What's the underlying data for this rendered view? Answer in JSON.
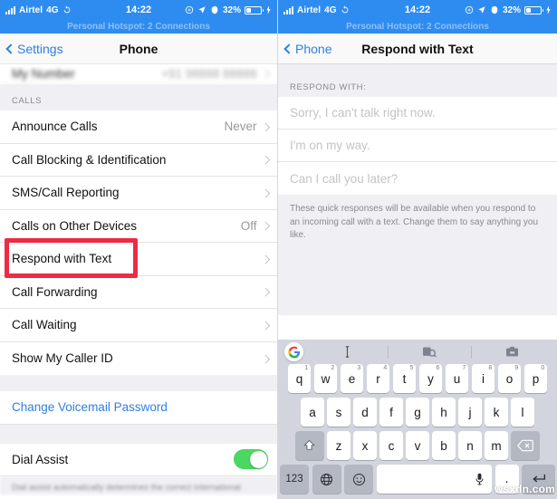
{
  "status_bar": {
    "carrier": "Airtel",
    "network": "4G",
    "time": "14:22",
    "battery_percent": "32%",
    "icons": [
      "signal-bars-icon",
      "sync-icon",
      "screen-mirroring-icon",
      "location-arrow-icon",
      "alarm-icon",
      "battery-icon",
      "charging-bolt-icon"
    ]
  },
  "hotspot_banner": "Personal Hotspot: 2 Connections",
  "left_screen": {
    "nav": {
      "back_label": "Settings",
      "title": "Phone"
    },
    "top_row": {
      "label": "My Number",
      "value": "+91 98888 88888"
    },
    "sections": [
      {
        "header": "CALLS",
        "rows": [
          {
            "label": "Announce Calls",
            "value": "Never",
            "chevron": true
          },
          {
            "label": "Call Blocking & Identification",
            "value": "",
            "chevron": true
          },
          {
            "label": "SMS/Call Reporting",
            "value": "",
            "chevron": true
          },
          {
            "label": "Calls on Other Devices",
            "value": "Off",
            "chevron": true
          },
          {
            "label": "Respond with Text",
            "value": "",
            "chevron": true
          },
          {
            "label": "Call Forwarding",
            "value": "",
            "chevron": true
          },
          {
            "label": "Call Waiting",
            "value": "",
            "chevron": true
          },
          {
            "label": "Show My Caller ID",
            "value": "",
            "chevron": true
          }
        ]
      }
    ],
    "voicemail_link": "Change Voicemail Password",
    "dial_assist": {
      "label": "Dial Assist",
      "enabled": true
    },
    "dial_assist_footnote": "Dial assist automatically determines the correct international"
  },
  "right_screen": {
    "nav": {
      "back_label": "Phone",
      "title": "Respond with Text"
    },
    "group_header": "RESPOND WITH:",
    "responses": [
      "Sorry, I can't talk right now.",
      "I'm on my way.",
      "Can I call you later?"
    ],
    "footnote": "These quick responses will be available when you respond to an incoming call with a text. Change them to say anything you like."
  },
  "keyboard": {
    "toolbar": [
      "google-logo-icon",
      "text-cursor-icon",
      "sticker-search-icon",
      "clipboard-icon"
    ],
    "row1": [
      {
        "key": "q",
        "num": "1"
      },
      {
        "key": "w",
        "num": "2"
      },
      {
        "key": "e",
        "num": "3"
      },
      {
        "key": "r",
        "num": "4"
      },
      {
        "key": "t",
        "num": "5"
      },
      {
        "key": "y",
        "num": "6"
      },
      {
        "key": "u",
        "num": "7"
      },
      {
        "key": "i",
        "num": "8"
      },
      {
        "key": "o",
        "num": "9"
      },
      {
        "key": "p",
        "num": "0"
      }
    ],
    "row2": [
      "a",
      "s",
      "d",
      "f",
      "g",
      "h",
      "j",
      "k",
      "l"
    ],
    "row3": [
      "z",
      "x",
      "c",
      "v",
      "b",
      "n",
      "m"
    ],
    "shift_label": "shift-icon",
    "backspace_label": "backspace-icon",
    "numbers_key": "123",
    "globe_key": "globe-icon",
    "emoji_key": "emoji-icon",
    "space_key": "",
    "mic_icon": "mic-icon",
    "period_key": ".",
    "enter_key": "enter-icon"
  },
  "highlight": {
    "color": "#ec2b44",
    "target": "Respond with Text"
  },
  "watermark": "wsxdn.com"
}
